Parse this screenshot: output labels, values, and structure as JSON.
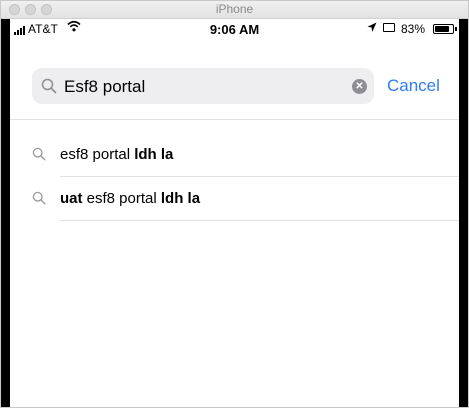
{
  "window": {
    "title": "iPhone"
  },
  "status_bar": {
    "carrier": "AT&T",
    "time": "9:06 AM",
    "battery_percent": "83%",
    "battery_level": 0.83
  },
  "search": {
    "query": "Esf8 portal",
    "cancel_label": "Cancel"
  },
  "suggestions": [
    {
      "parts": [
        {
          "text": "esf8 portal ",
          "bold": false
        },
        {
          "text": "ldh la",
          "bold": true
        }
      ]
    },
    {
      "parts": [
        {
          "text": "uat",
          "bold": true
        },
        {
          "text": " esf8 portal ",
          "bold": false
        },
        {
          "text": "ldh la",
          "bold": true
        }
      ]
    }
  ],
  "icons": [
    "search-icon",
    "clear-icon",
    "location-arrow-icon",
    "airplay-icon",
    "battery-icon",
    "wifi-icon",
    "signal-icon"
  ]
}
